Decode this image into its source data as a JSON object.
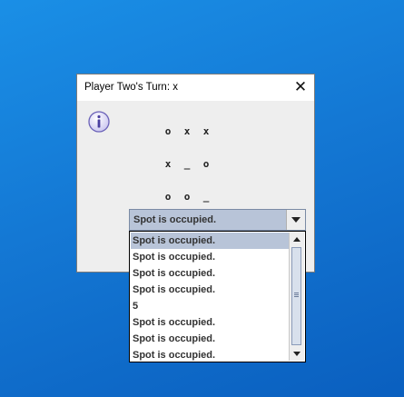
{
  "dialog": {
    "title": "Player Two's Turn: x",
    "close_glyph": "✕"
  },
  "board": {
    "rows": [
      [
        "o",
        "x",
        "x"
      ],
      [
        "x",
        "_",
        "o"
      ],
      [
        "o",
        "o",
        "_"
      ]
    ]
  },
  "combo": {
    "selected": "Spot is occupied."
  },
  "list": {
    "items": [
      "Spot is occupied.",
      "Spot is occupied.",
      "Spot is occupied.",
      "Spot is occupied.",
      "5",
      "Spot is occupied.",
      "Spot is occupied.",
      "Spot is occupied."
    ],
    "selected_index": 0
  },
  "colors": {
    "selection": "#b8c4d8",
    "desktop": "#1478d4"
  }
}
